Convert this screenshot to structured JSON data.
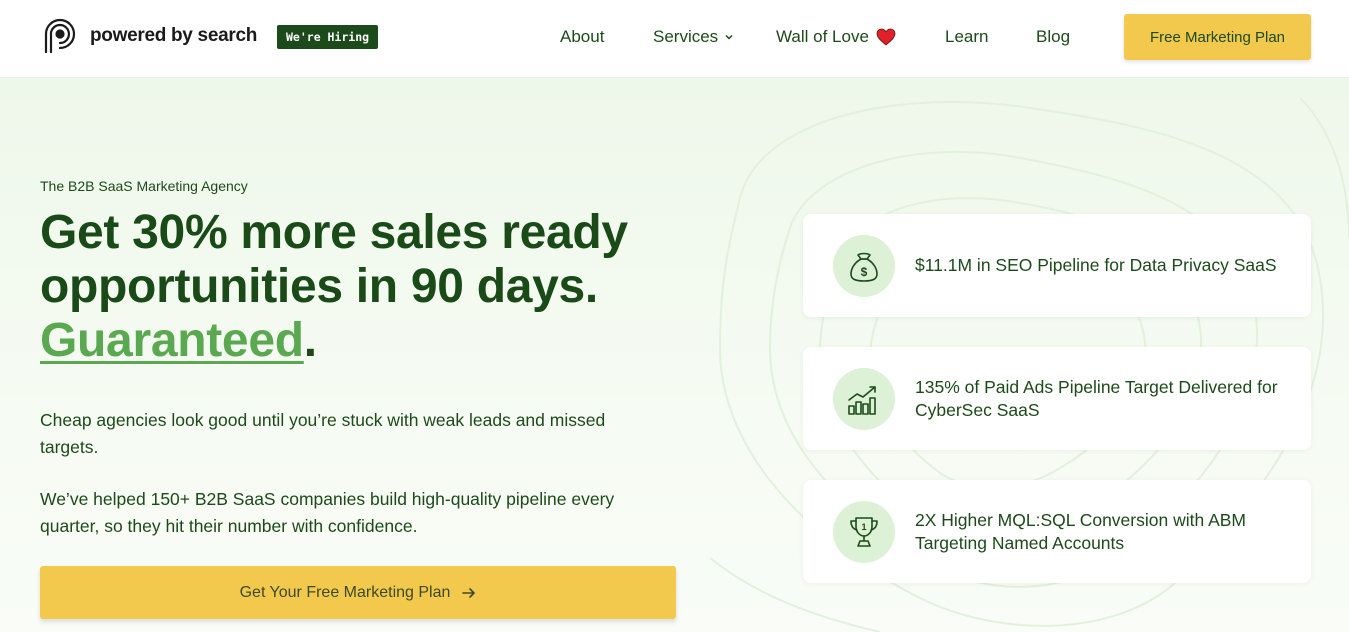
{
  "header": {
    "logo_text": "powered by search",
    "hiring_badge": "We're Hiring",
    "nav": {
      "about": "About",
      "services": "Services",
      "wall_of_love": "Wall of Love",
      "learn": "Learn",
      "blog": "Blog"
    },
    "cta": "Free Marketing Plan"
  },
  "hero": {
    "eyebrow": "The B2B SaaS Marketing Agency",
    "headline_line1": "Get 30% more sales ready",
    "headline_line2": "opportunities in 90 days.",
    "headline_accent": "Guaranteed",
    "headline_period": ".",
    "paragraph1": "Cheap agencies look good until you’re stuck with weak leads and missed targets.",
    "paragraph2": "We’ve helped 150+ B2B SaaS companies build high-quality pipeline every quarter, so they hit their number with confidence.",
    "cta": "Get Your Free Marketing Plan"
  },
  "cards": [
    {
      "icon": "money-bag-icon",
      "text": "$11.1M in SEO Pipeline for Data Privacy SaaS"
    },
    {
      "icon": "growth-chart-icon",
      "text": "135% of Paid Ads Pipeline Target Delivered for CyberSec SaaS"
    },
    {
      "icon": "trophy-icon",
      "text": "2X Higher MQL:SQL Conversion with ABM Targeting Named Accounts"
    }
  ],
  "colors": {
    "brand_dark": "#1d4a1a",
    "accent_green": "#5aa84f",
    "cta_yellow": "#f2c94c",
    "icon_bg": "#dcf1d6",
    "heart": "#e0202a"
  }
}
